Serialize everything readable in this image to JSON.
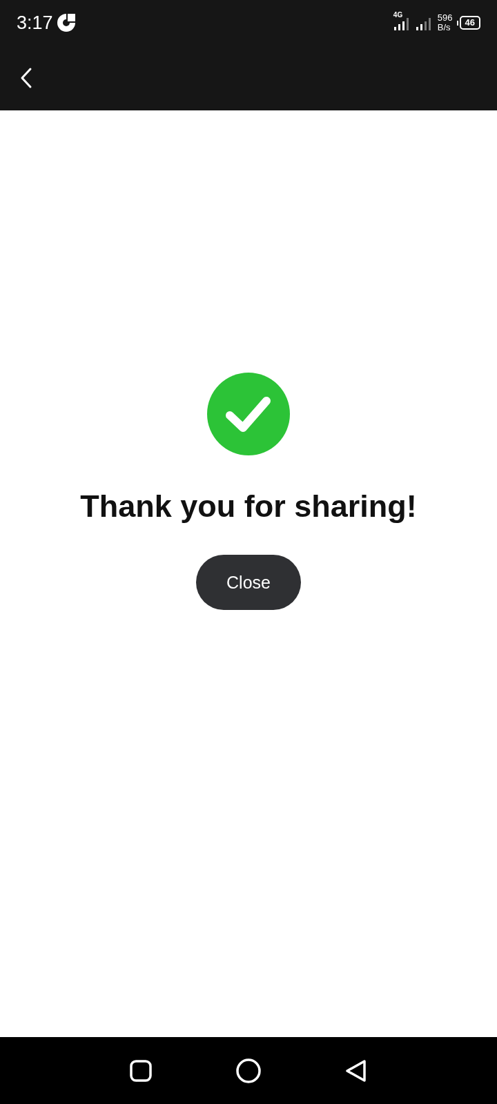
{
  "status_bar": {
    "time": "3:17",
    "network_type": "4G",
    "speed_value": "596",
    "speed_unit": "B/s",
    "battery": "46"
  },
  "message": {
    "title": "Thank you for sharing!",
    "button": "Close"
  }
}
